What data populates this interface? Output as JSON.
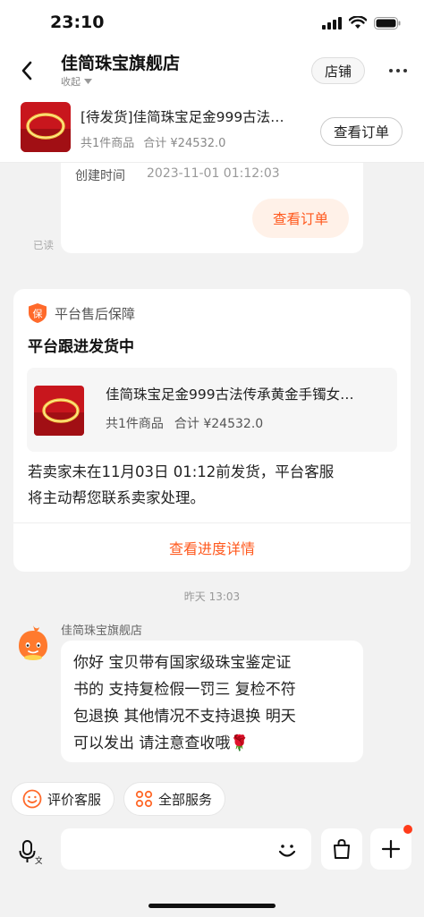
{
  "status_bar": {
    "time": "23:10"
  },
  "header": {
    "title": "佳简珠宝旗舰店",
    "follow_label": "收起",
    "shop_button": "店铺"
  },
  "order_bar": {
    "title": "[待发货]佳简珠宝足金999古法…",
    "item_count": "共1件商品",
    "total": "合计 ¥24532.0",
    "view_order": "查看订单"
  },
  "prev_card": {
    "created_label": "创建时间",
    "created_value": "2023-11-01 01:12:03",
    "view_order": "查看订单",
    "read_label": "已读"
  },
  "guarantee": {
    "icon_text": "保",
    "label": "平台售后保障",
    "title": "平台跟进发货中",
    "product_title": "佳简珠宝足金999古法传承黄金手镯女…",
    "item_count": "共1件商品",
    "total": "合计 ¥24532.0",
    "notice_line1": "若卖家未在11月03日 01:12前发货，平台客服",
    "notice_line2": "将主动帮您联系卖家处理。",
    "progress_link": "查看进度详情"
  },
  "chat": {
    "time_separator": "昨天 13:03",
    "sender": "佳简珠宝旗舰店",
    "message_line1": "你好 宝贝带有国家级珠宝鉴定证",
    "message_line2": "书的 支持复检假一罚三 复检不符",
    "message_line3": "包退换 其他情况不支持退换 明天",
    "message_line4": "可以发出 请注意查收哦",
    "message_emoji": "🌹"
  },
  "quick_actions": [
    {
      "label": "评价客服",
      "icon": "smile-icon"
    },
    {
      "label": "全部服务",
      "icon": "services-grid-icon"
    }
  ],
  "input_bar": {
    "placeholder": ""
  },
  "colors": {
    "accent": "#ff5a1f",
    "accent_bg": "#fff1e8",
    "page_bg": "#f2f2f2",
    "notification_dot": "#ff3b1a"
  }
}
